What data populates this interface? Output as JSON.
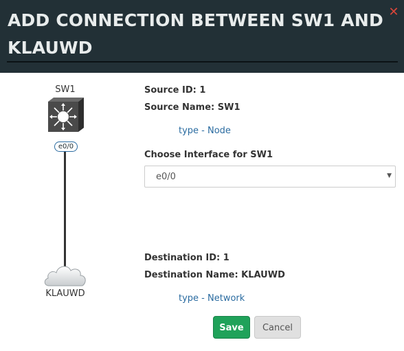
{
  "dialog": {
    "title": "ADD CONNECTION BETWEEN SW1 AND KLAUWD",
    "close_icon": "close-icon",
    "colors": {
      "header": "#223036",
      "close": "#d9463a",
      "link": "#2a6ba0",
      "save": "#20a25a"
    }
  },
  "diagram": {
    "source_node": {
      "label": "SW1",
      "icon": "switch-icon"
    },
    "interface_badge": "e0/0",
    "destination_node": {
      "label": "KLAUWD",
      "icon": "cloud-icon"
    }
  },
  "source": {
    "id_label": "Source ID: 1",
    "name_label": "Source Name: SW1",
    "type_label": "type - Node"
  },
  "interface_select": {
    "label": "Choose Interface for SW1",
    "value": "e0/0"
  },
  "destination": {
    "id_label": "Destination ID: 1",
    "name_label": "Destination Name: KLAUWD",
    "type_label": "type - Network"
  },
  "buttons": {
    "save": "Save",
    "cancel": "Cancel"
  }
}
